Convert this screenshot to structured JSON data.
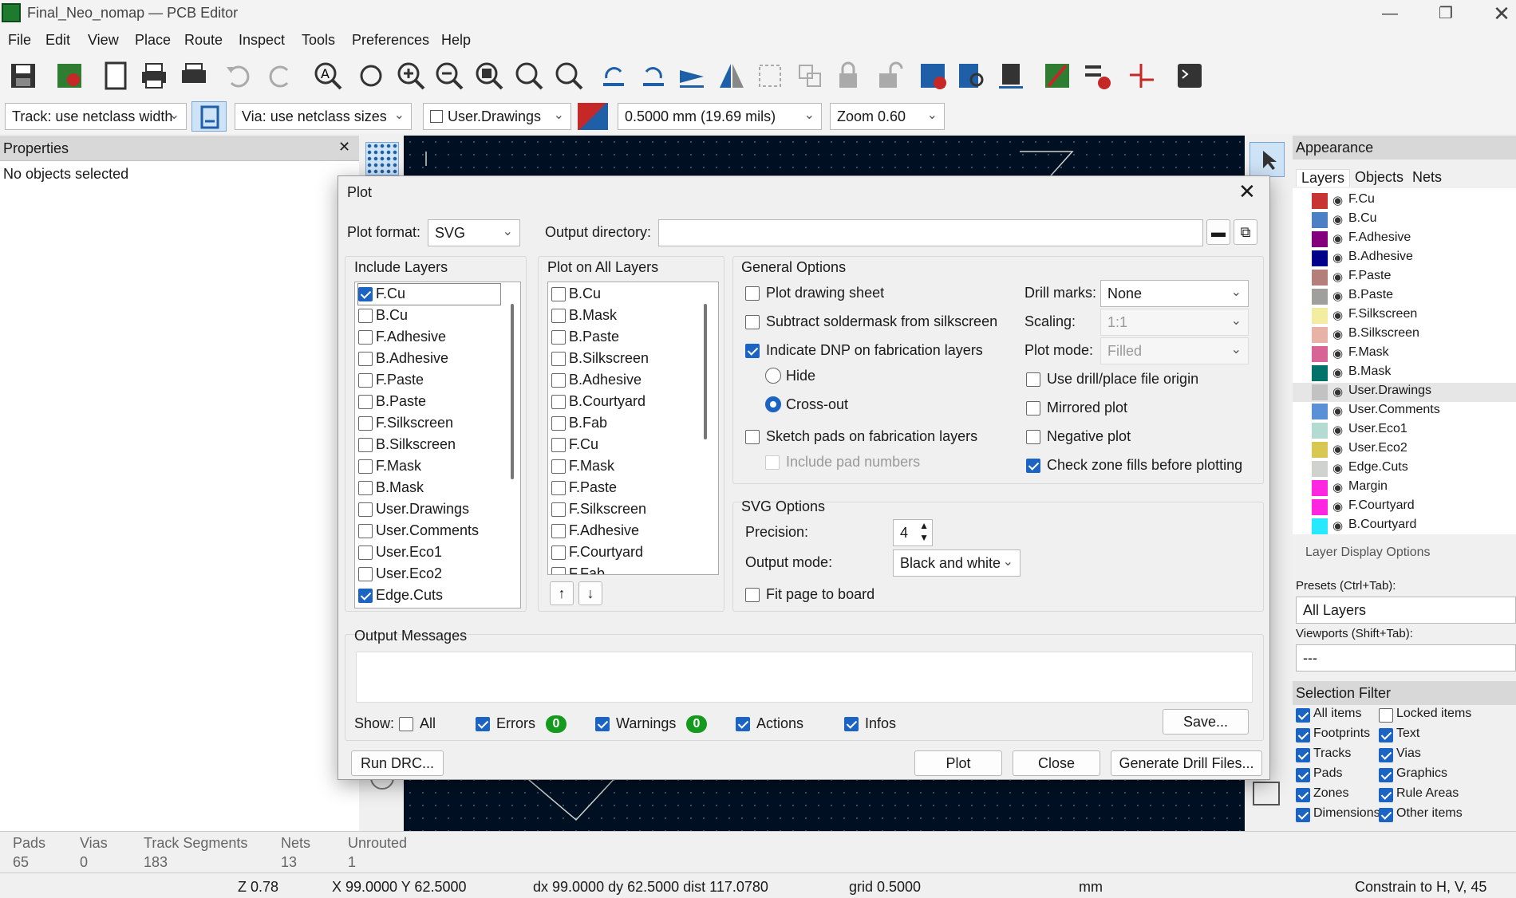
{
  "window": {
    "title": "Final_Neo_nomap — PCB Editor"
  },
  "menu": [
    "File",
    "Edit",
    "View",
    "Place",
    "Route",
    "Inspect",
    "Tools",
    "Preferences",
    "Help"
  ],
  "optbar": {
    "track": "Track: use netclass width",
    "via": "Via: use netclass sizes",
    "layer": "User.Drawings",
    "grid": "0.5000 mm (19.69 mils)",
    "zoom": "Zoom 0.60"
  },
  "properties": {
    "title": "Properties",
    "empty": "No objects selected"
  },
  "appearance": {
    "title": "Appearance",
    "tabs": [
      "Layers",
      "Objects",
      "Nets"
    ],
    "layers": [
      {
        "name": "F.Cu",
        "color": "#c83434"
      },
      {
        "name": "B.Cu",
        "color": "#4d7fc4"
      },
      {
        "name": "F.Adhesive",
        "color": "#84007c"
      },
      {
        "name": "B.Adhesive",
        "color": "#00008a"
      },
      {
        "name": "F.Paste",
        "color": "#b47f7b"
      },
      {
        "name": "B.Paste",
        "color": "#9f9f9b"
      },
      {
        "name": "F.Silkscreen",
        "color": "#f2eda1"
      },
      {
        "name": "B.Silkscreen",
        "color": "#e8b2a7"
      },
      {
        "name": "F.Mask",
        "color": "#d86496"
      },
      {
        "name": "B.Mask",
        "color": "#02736b"
      },
      {
        "name": "User.Drawings",
        "color": "#c2c2c2"
      },
      {
        "name": "User.Comments",
        "color": "#5990d6"
      },
      {
        "name": "User.Eco1",
        "color": "#b4dbd2"
      },
      {
        "name": "User.Eco2",
        "color": "#d8c852"
      },
      {
        "name": "Edge.Cuts",
        "color": "#d0d2cd"
      },
      {
        "name": "Margin",
        "color": "#ff26e2"
      },
      {
        "name": "F.Courtyard",
        "color": "#ff26e2"
      },
      {
        "name": "B.Courtyard",
        "color": "#26e9ff"
      }
    ],
    "layer_display": "Layer Display Options",
    "presets_label": "Presets (Ctrl+Tab):",
    "presets_value": "All Layers",
    "viewports_label": "Viewports (Shift+Tab):",
    "viewports_value": "---",
    "selection_filter": "Selection Filter",
    "filters_left": [
      "All items",
      "Footprints",
      "Tracks",
      "Pads",
      "Zones",
      "Dimensions"
    ],
    "filters_right": [
      "Locked items",
      "Text",
      "Vias",
      "Graphics",
      "Rule Areas",
      "Other items"
    ],
    "filters_right_checked": [
      false,
      true,
      true,
      true,
      true,
      true
    ]
  },
  "status": {
    "labels": [
      "Pads",
      "Vias",
      "Track Segments",
      "Nets",
      "Unrouted"
    ],
    "values": [
      "65",
      "0",
      "183",
      "13",
      "1"
    ],
    "bottom": [
      "Z 0.78",
      "X 99.0000  Y 62.5000",
      "dx 99.0000  dy 62.5000  dist 117.0780",
      "grid 0.5000",
      "mm",
      "Constrain to H, V, 45"
    ]
  },
  "dialog": {
    "title": "Plot",
    "plot_format_label": "Plot format:",
    "plot_format": "SVG",
    "output_dir_label": "Output directory:",
    "output_dir": "",
    "include_layers_label": "Include Layers",
    "include_layers": [
      {
        "n": "F.Cu",
        "c": true
      },
      {
        "n": "B.Cu",
        "c": false
      },
      {
        "n": "F.Adhesive",
        "c": false
      },
      {
        "n": "B.Adhesive",
        "c": false
      },
      {
        "n": "F.Paste",
        "c": false
      },
      {
        "n": "B.Paste",
        "c": false
      },
      {
        "n": "F.Silkscreen",
        "c": false
      },
      {
        "n": "B.Silkscreen",
        "c": false
      },
      {
        "n": "F.Mask",
        "c": false
      },
      {
        "n": "B.Mask",
        "c": false
      },
      {
        "n": "User.Drawings",
        "c": false
      },
      {
        "n": "User.Comments",
        "c": false
      },
      {
        "n": "User.Eco1",
        "c": false
      },
      {
        "n": "User.Eco2",
        "c": false
      },
      {
        "n": "Edge.Cuts",
        "c": true
      }
    ],
    "all_layers_label": "Plot on All Layers",
    "all_layers": [
      "B.Cu",
      "B.Mask",
      "B.Paste",
      "B.Silkscreen",
      "B.Adhesive",
      "B.Courtyard",
      "B.Fab",
      "F.Cu",
      "F.Mask",
      "F.Paste",
      "F.Silkscreen",
      "F.Adhesive",
      "F.Courtyard",
      "F.Fab"
    ],
    "general_label": "General Options",
    "plot_drawing_sheet": "Plot drawing sheet",
    "subtract_mask": "Subtract soldermask from silkscreen",
    "indicate_dnp": "Indicate DNP on fabrication layers",
    "hide": "Hide",
    "crossout": "Cross-out",
    "sketch_pads": "Sketch pads on fabrication layers",
    "include_pad_numbers": "Include pad numbers",
    "drill_marks_label": "Drill marks:",
    "drill_marks": "None",
    "scaling_label": "Scaling:",
    "scaling": "1:1",
    "plot_mode_label": "Plot mode:",
    "plot_mode": "Filled",
    "use_drill_origin": "Use drill/place file origin",
    "mirrored": "Mirrored plot",
    "negative": "Negative plot",
    "check_zones": "Check zone fills before plotting",
    "svg_label": "SVG Options",
    "precision_label": "Precision:",
    "precision": "4",
    "output_mode_label": "Output mode:",
    "output_mode": "Black and white",
    "fit_page": "Fit page to board",
    "messages_label": "Output Messages",
    "show_label": "Show:",
    "show_all": "All",
    "errors": "Errors",
    "errors_count": "0",
    "warnings": "Warnings",
    "warnings_count": "0",
    "actions": "Actions",
    "infos": "Infos",
    "save": "Save...",
    "run_drc": "Run DRC...",
    "plot": "Plot",
    "close": "Close",
    "gen_drill": "Generate Drill Files..."
  }
}
